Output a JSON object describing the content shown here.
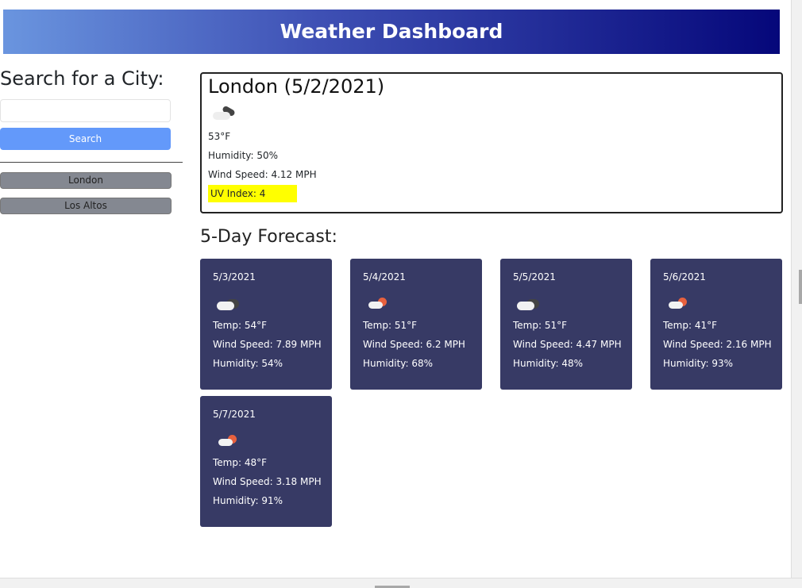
{
  "header": {
    "title": "Weather Dashboard"
  },
  "sidebar": {
    "heading": "Search for a City:",
    "search_value": "",
    "search_button": "Search",
    "history": [
      "London",
      "Los Altos"
    ]
  },
  "current": {
    "title": "London (5/2/2021)",
    "icon": "broken-clouds-icon",
    "temp": "53°F",
    "humidity": "Humidity: 50%",
    "wind": "Wind Speed: 4.12 MPH",
    "uv": "UV Index: 4",
    "uv_color": "#ffff00"
  },
  "forecast": {
    "heading": "5-Day Forecast:",
    "days": [
      {
        "date": "5/3/2021",
        "icon": "broken-clouds-icon",
        "temp": "Temp: 54°F",
        "wind": "Wind Speed: 7.89 MPH",
        "humidity": "Humidity: 54%"
      },
      {
        "date": "5/4/2021",
        "icon": "few-clouds-icon",
        "temp": "Temp: 51°F",
        "wind": "Wind Speed: 6.2 MPH",
        "humidity": "Humidity: 68%"
      },
      {
        "date": "5/5/2021",
        "icon": "broken-clouds-icon",
        "temp": "Temp: 51°F",
        "wind": "Wind Speed: 4.47 MPH",
        "humidity": "Humidity: 48%"
      },
      {
        "date": "5/6/2021",
        "icon": "few-clouds-icon",
        "temp": "Temp: 41°F",
        "wind": "Wind Speed: 2.16 MPH",
        "humidity": "Humidity: 93%"
      },
      {
        "date": "5/7/2021",
        "icon": "few-clouds-icon",
        "temp": "Temp: 48°F",
        "wind": "Wind Speed: 3.18 MPH",
        "humidity": "Humidity: 91%"
      }
    ]
  }
}
